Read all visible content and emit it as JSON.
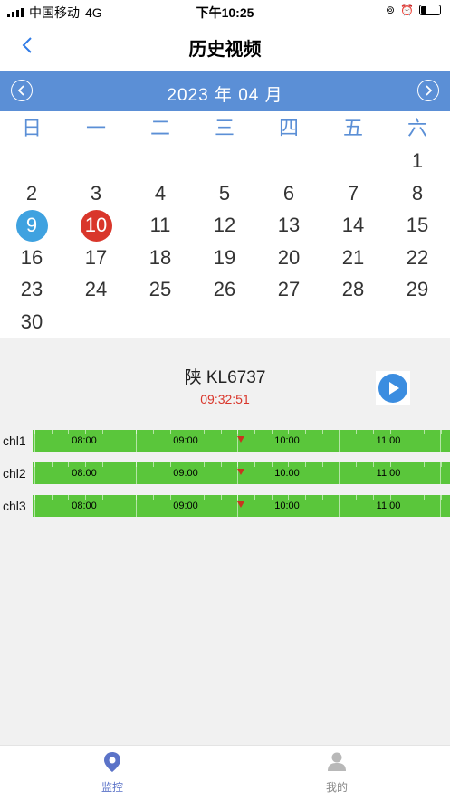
{
  "status": {
    "carrier": "中国移动",
    "network": "4G",
    "time": "下午10:25"
  },
  "nav": {
    "title": "历史视频"
  },
  "calendar": {
    "month_label": "2023 年 04 月",
    "weekdays": [
      "日",
      "一",
      "二",
      "三",
      "四",
      "五",
      "六"
    ],
    "weeks": [
      [
        "",
        "",
        "",
        "",
        "",
        "",
        "1"
      ],
      [
        "2",
        "3",
        "4",
        "5",
        "6",
        "7",
        "8"
      ],
      [
        "9",
        "10",
        "11",
        "12",
        "13",
        "14",
        "15"
      ],
      [
        "16",
        "17",
        "18",
        "19",
        "20",
        "21",
        "22"
      ],
      [
        "23",
        "24",
        "25",
        "26",
        "27",
        "28",
        "29"
      ],
      [
        "30",
        "",
        "",
        "",
        "",
        "",
        ""
      ]
    ],
    "today": "9",
    "selected": "10"
  },
  "video": {
    "plate": "陕 KL6737",
    "current_time": "09:32:51"
  },
  "timeline": {
    "channels": [
      "chl1",
      "chl2",
      "chl3"
    ],
    "ticks": [
      "08:00",
      "09:00",
      "10:00",
      "11:00"
    ],
    "track_color": "#5ac63b",
    "marker_color": "#c8351f"
  },
  "tabs": [
    {
      "label": "监控",
      "icon": "location-pin-icon",
      "active": true,
      "color": "#5b73c8"
    },
    {
      "label": "我的",
      "icon": "user-icon",
      "active": false,
      "color": "#888888"
    }
  ]
}
